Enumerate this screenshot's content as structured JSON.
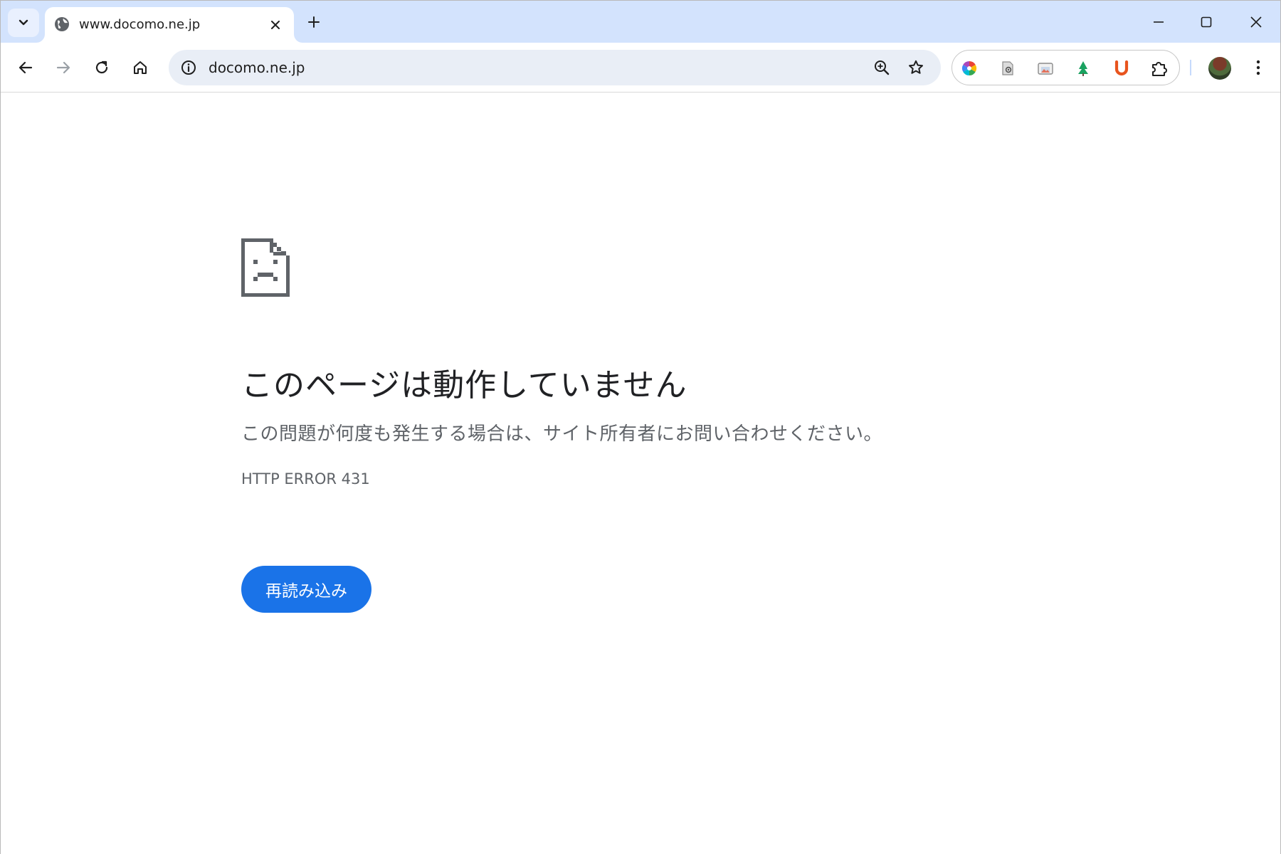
{
  "tab": {
    "title": "www.docomo.ne.jp"
  },
  "omnibox": {
    "url": "docomo.ne.jp"
  },
  "error": {
    "heading": "このページは動作していません",
    "description": "この問題が何度も発生する場合は、サイト所有者にお問い合わせください。",
    "code": "HTTP ERROR 431",
    "reload_label": "再読み込み"
  },
  "colors": {
    "tabstrip": "#d3e3fd",
    "omnibox": "#e9eef6",
    "primary_button": "#1a73e8"
  },
  "icons": {
    "tab_search": "chevron-down-icon",
    "favicon": "globe-icon",
    "tab_close": "close-icon",
    "new_tab": "plus-icon",
    "minimize": "minimize-icon",
    "maximize": "maximize-icon",
    "close_window": "close-icon",
    "back": "arrow-left-icon",
    "forward": "arrow-right-icon",
    "reload": "reload-icon",
    "home": "home-icon",
    "site_info": "info-icon",
    "zoom": "zoom-in-icon",
    "bookmark": "star-icon",
    "extensions": [
      "color-wheel-icon",
      "document-at-icon",
      "screenshot-icon",
      "tree-icon",
      "u-icon",
      "puzzle-icon"
    ],
    "menu": "kebab-menu-icon",
    "error": "sad-document-icon"
  }
}
